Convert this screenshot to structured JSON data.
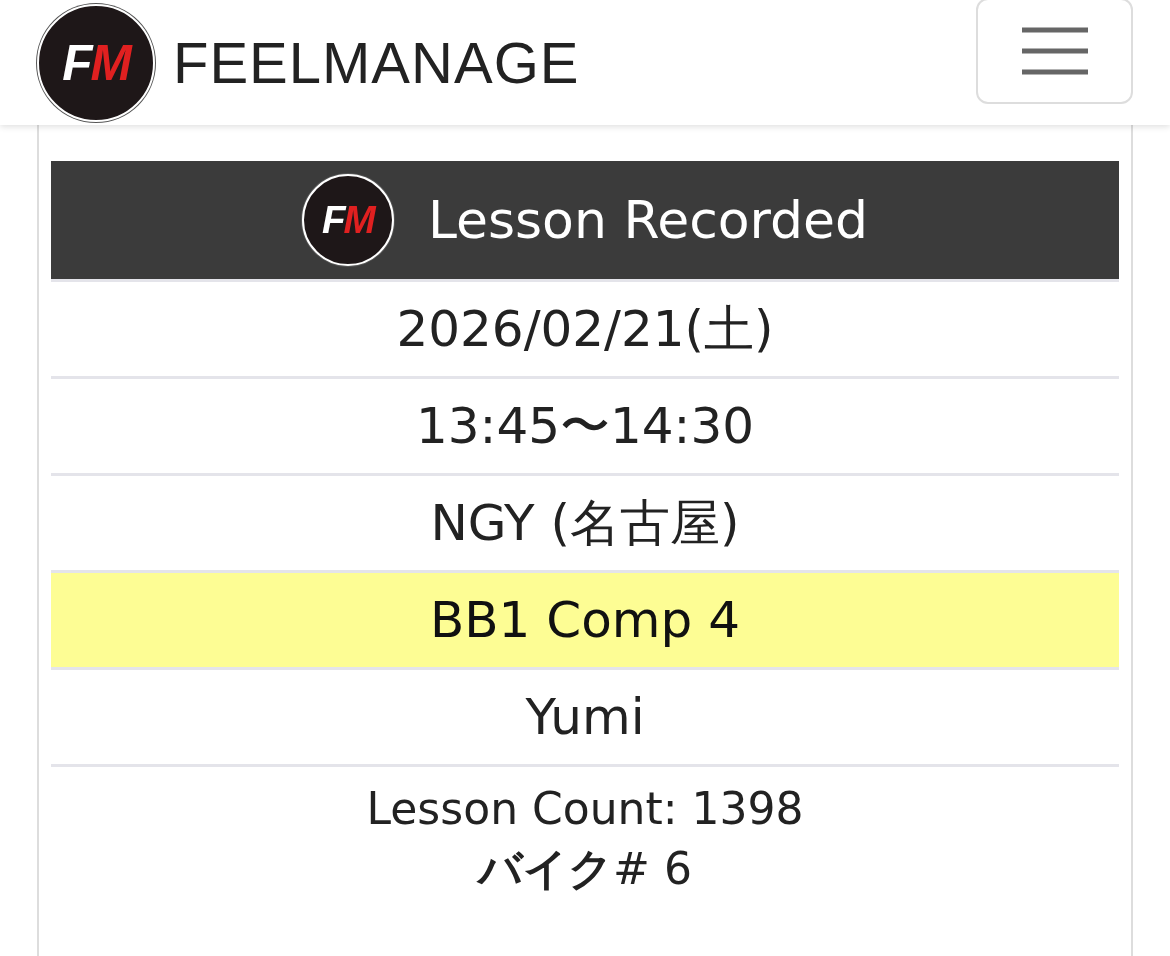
{
  "header": {
    "logo": {
      "first": "F",
      "second": "M"
    },
    "brand": "FEELMANAGE"
  },
  "card": {
    "logo": {
      "first": "F",
      "second": "M"
    },
    "title": "Lesson Recorded",
    "rows": [
      {
        "text": "2026/02/21(土)",
        "highlighted": false
      },
      {
        "text": "13:45〜14:30",
        "highlighted": false
      },
      {
        "text": "NGY (名古屋)",
        "highlighted": false
      },
      {
        "text": "BB1 Comp 4",
        "highlighted": true
      },
      {
        "text": "Yumi",
        "highlighted": false
      }
    ],
    "lesson_count": "Lesson Count: 1398",
    "bike": "**バイク**# 6"
  }
}
